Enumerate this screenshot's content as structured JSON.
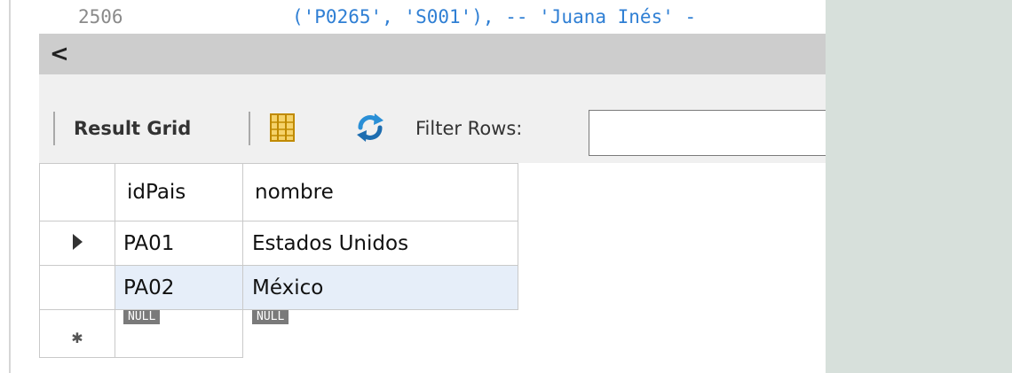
{
  "editor": {
    "line_number": "2506",
    "code": "('P0265', 'S001'), -- 'Juana Inés' -"
  },
  "scroll": {
    "left_arrow": "<"
  },
  "toolbar": {
    "result_grid_label": "Result Grid",
    "filter_label": "Filter Rows:",
    "filter_value": "",
    "icons": [
      "grid-layout-icon",
      "refresh-icon"
    ]
  },
  "grid": {
    "columns": [
      "idPais",
      "nombre"
    ],
    "rows": [
      {
        "idPais": "PA01",
        "nombre": "Estados Unidos"
      },
      {
        "idPais": "PA02",
        "nombre": "México"
      }
    ],
    "null_row": {
      "idPais": "NULL",
      "nombre": "NULL"
    }
  },
  "colors": {
    "selection_row": "#e6eef9",
    "toolbar_bg": "#f0f0f0",
    "side_panel": "#d7e0db",
    "null_badge": "#7a7a7a"
  }
}
